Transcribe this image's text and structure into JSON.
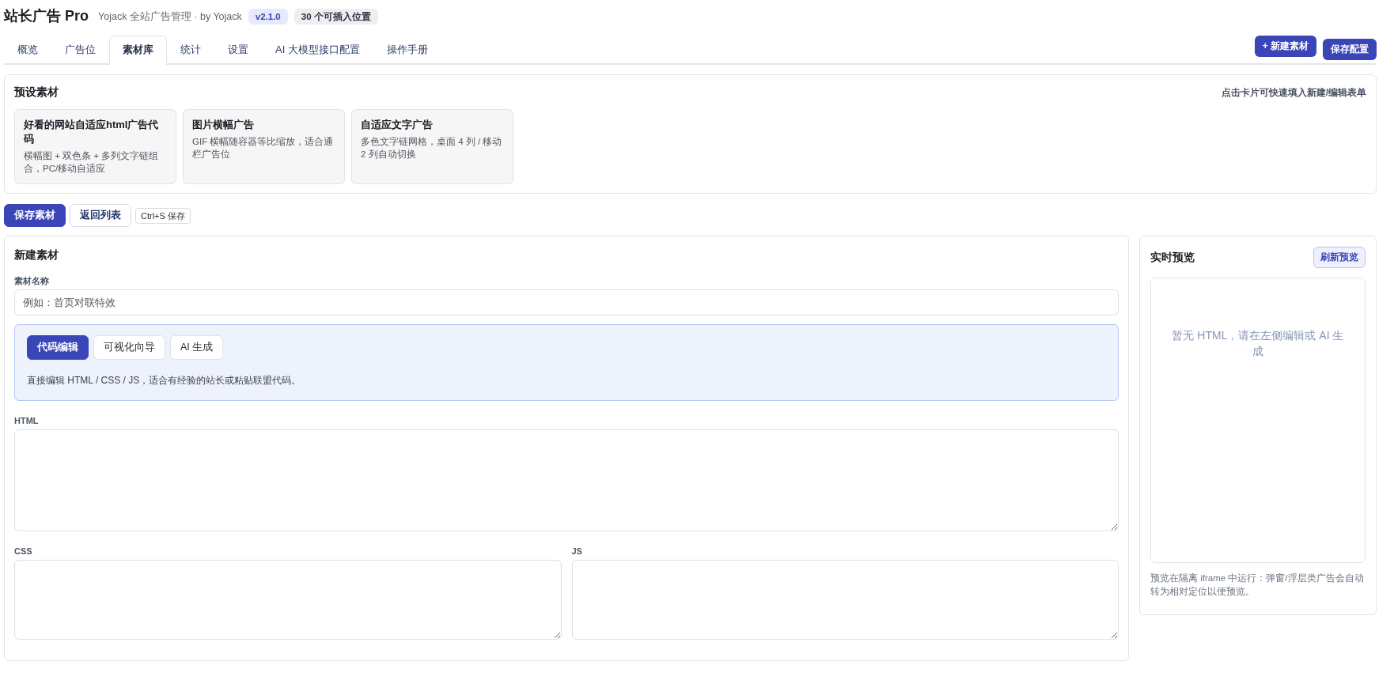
{
  "header": {
    "title": "站长广告 Pro",
    "subtitle": "Yojack 全站广告管理 · by Yojack",
    "badges": [
      {
        "text": "v2.1.0",
        "kind": "version"
      },
      {
        "text": "30 个可插入位置",
        "kind": "count"
      }
    ]
  },
  "tabs": [
    {
      "label": "概览",
      "selected": false
    },
    {
      "label": "广告位",
      "selected": false
    },
    {
      "label": "素材库",
      "selected": true
    },
    {
      "label": "统计",
      "selected": false
    },
    {
      "label": "设置",
      "selected": false
    },
    {
      "label": "AI 大模型接口配置",
      "selected": false
    },
    {
      "label": "操作手册",
      "selected": false
    }
  ],
  "toolbar_buttons": [
    {
      "label": "+ 新建素材"
    },
    {
      "label": "保存配置"
    }
  ],
  "presets": {
    "title": "预设素材",
    "hint": "点击卡片可快速填入新建/编辑表单",
    "cards": [
      {
        "title": "好看的网站自适应html广告代码",
        "description": "横幅图 + 双色条 + 多列文字链组合，PC/移动自适应"
      },
      {
        "title": "图片横幅广告",
        "description": "GIF 横幅随容器等比缩放，适合通栏广告位"
      },
      {
        "title": "自适应文字广告",
        "description": "多色文字链网格，桌面 4 列 / 移动 2 列自动切换"
      }
    ]
  },
  "actions": {
    "buttons": [
      {
        "label": "保存素材",
        "kind": "primary"
      },
      {
        "label": "返回列表",
        "kind": "secondary"
      }
    ],
    "shortcut": "Ctrl+S 保存"
  },
  "editor": {
    "title": "新建素材",
    "name_field": {
      "label": "素材名称",
      "placeholder": "例如：首页对联特效"
    },
    "modes": [
      {
        "label": "代码编辑",
        "selected": true
      },
      {
        "label": "可视化向导",
        "selected": false
      },
      {
        "label": "AI 生成",
        "selected": false
      }
    ],
    "mode_description": "直接编辑 HTML / CSS / JS，适合有经验的站长或粘贴联盟代码。",
    "code_fields": [
      {
        "label": "HTML"
      },
      {
        "label": "CSS"
      },
      {
        "label": "JS"
      }
    ]
  },
  "preview": {
    "title": "实时预览",
    "refresh_button": "刷新预览",
    "empty_message": "暂无 HTML，请在左侧编辑或 AI 生成",
    "note": "预览在隔离 iframe 中运行：弹窗/浮层类广告会自动转为相对定位以便预览。"
  }
}
